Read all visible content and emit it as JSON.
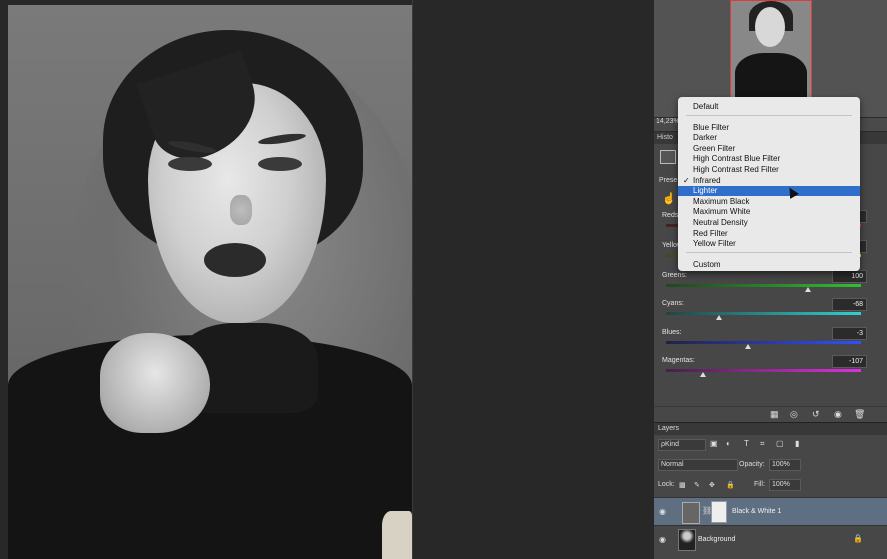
{
  "navigator": {
    "zoom": "14,23%"
  },
  "history_tab": {
    "label": "Histo"
  },
  "properties": {
    "preset_label": "Prese",
    "sliders": [
      {
        "label": "Reds:",
        "value": "",
        "thumb_pct": 0.45,
        "colors": [
          "#442222",
          "#ff3030"
        ]
      },
      {
        "label": "Yellows:",
        "value": "",
        "thumb_pct": 0.55,
        "colors": [
          "#444422",
          "#e8e040"
        ]
      },
      {
        "label": "Greens:",
        "value": "100",
        "thumb_pct": 0.73,
        "colors": [
          "#224422",
          "#30c030"
        ]
      },
      {
        "label": "Cyans:",
        "value": "-68",
        "thumb_pct": 0.27,
        "colors": [
          "#224444",
          "#30d0d0"
        ]
      },
      {
        "label": "Blues:",
        "value": "-3",
        "thumb_pct": 0.42,
        "colors": [
          "#222244",
          "#3050ff"
        ]
      },
      {
        "label": "Magentas:",
        "value": "-107",
        "thumb_pct": 0.19,
        "colors": [
          "#442244",
          "#e030e0"
        ]
      }
    ]
  },
  "preset_menu": {
    "items": [
      {
        "label": "Default",
        "group": 0
      },
      {
        "label": "Blue Filter",
        "group": 1
      },
      {
        "label": "Darker",
        "group": 1
      },
      {
        "label": "Green Filter",
        "group": 1
      },
      {
        "label": "High Contrast Blue Filter",
        "group": 1
      },
      {
        "label": "High Contrast Red Filter",
        "group": 1
      },
      {
        "label": "Infrared",
        "group": 1,
        "checked": true
      },
      {
        "label": "Lighter",
        "group": 1,
        "highlighted": true
      },
      {
        "label": "Maximum Black",
        "group": 1
      },
      {
        "label": "Maximum White",
        "group": 1
      },
      {
        "label": "Neutral Density",
        "group": 1
      },
      {
        "label": "Red Filter",
        "group": 1
      },
      {
        "label": "Yellow Filter",
        "group": 1
      },
      {
        "label": "Custom",
        "group": 2
      }
    ],
    "check_mark": "✓"
  },
  "layers": {
    "tab_label": "Layers",
    "kind_filter": "ρKind",
    "blend_mode": "Normal",
    "opacity_label": "Opacity:",
    "opacity_value": "100%",
    "lock_label": "Lock:",
    "fill_label": "Fill:",
    "fill_value": "100%",
    "rows": [
      {
        "name": "Black & White 1",
        "selected": true
      },
      {
        "name": "Background",
        "selected": false
      }
    ]
  },
  "icons": {
    "eye": "eye-icon",
    "hand": "hand-icon",
    "lock": "lock-icon"
  }
}
